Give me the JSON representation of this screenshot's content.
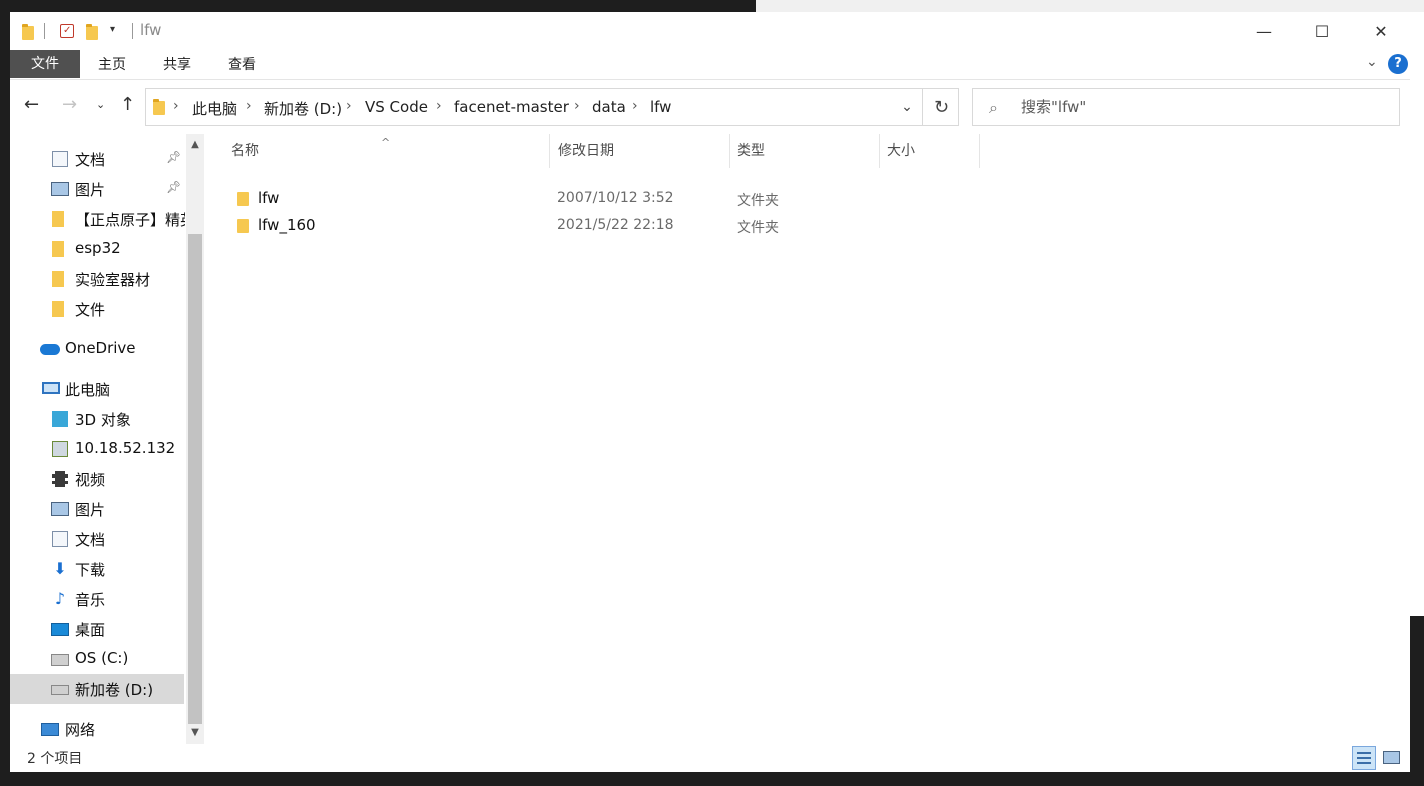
{
  "window": {
    "title": "lfw",
    "controls": {
      "minimize": "—",
      "maximize": "☐",
      "close": "✕"
    }
  },
  "ribbon": {
    "tabs": [
      {
        "label": "文件"
      },
      {
        "label": "主页"
      },
      {
        "label": "共享"
      },
      {
        "label": "查看"
      }
    ],
    "help": "?"
  },
  "address": {
    "crumbs": [
      "此电脑",
      "新加卷 (D:)",
      "VS Code",
      "facenet-master",
      "data",
      "lfw"
    ]
  },
  "search": {
    "placeholder": "搜索\"lfw\""
  },
  "nav": {
    "quick_access": [
      {
        "label": "文档",
        "icon": "document-icon",
        "pinned": true
      },
      {
        "label": "图片",
        "icon": "picture-icon",
        "pinned": true
      },
      {
        "label": "【正点原子】精英",
        "icon": "folder-icon",
        "pinned": false
      },
      {
        "label": "esp32",
        "icon": "folder-icon",
        "pinned": false
      },
      {
        "label": "实验室器材",
        "icon": "folder-icon",
        "pinned": false
      },
      {
        "label": "文件",
        "icon": "folder-icon",
        "pinned": false
      }
    ],
    "onedrive": "OneDrive",
    "this_pc": "此电脑",
    "pc_items": [
      {
        "label": "3D 对象",
        "icon": "cube-icon"
      },
      {
        "label": "10.18.52.132",
        "icon": "network-drive-icon"
      },
      {
        "label": "视频",
        "icon": "video-icon"
      },
      {
        "label": "图片",
        "icon": "picture-icon"
      },
      {
        "label": "文档",
        "icon": "document-icon"
      },
      {
        "label": "下载",
        "icon": "download-icon"
      },
      {
        "label": "音乐",
        "icon": "music-icon"
      },
      {
        "label": "桌面",
        "icon": "desktop-icon"
      },
      {
        "label": "OS (C:)",
        "icon": "windows-drive-icon"
      },
      {
        "label": "新加卷 (D:)",
        "icon": "drive-icon"
      }
    ],
    "network": "网络"
  },
  "columns": {
    "name": "名称",
    "date": "修改日期",
    "type": "类型",
    "size": "大小"
  },
  "files": [
    {
      "name": "lfw",
      "date": "2007/10/12 3:52",
      "type": "文件夹",
      "size": ""
    },
    {
      "name": "lfw_160",
      "date": "2021/5/22 22:18",
      "type": "文件夹",
      "size": ""
    }
  ],
  "status": {
    "item_count": "2 个项目"
  },
  "colors": {
    "accent": "#1a6fd0",
    "folder": "#f6c850",
    "selected_nav": "#d9d9d9",
    "file_tab": "#505050"
  }
}
